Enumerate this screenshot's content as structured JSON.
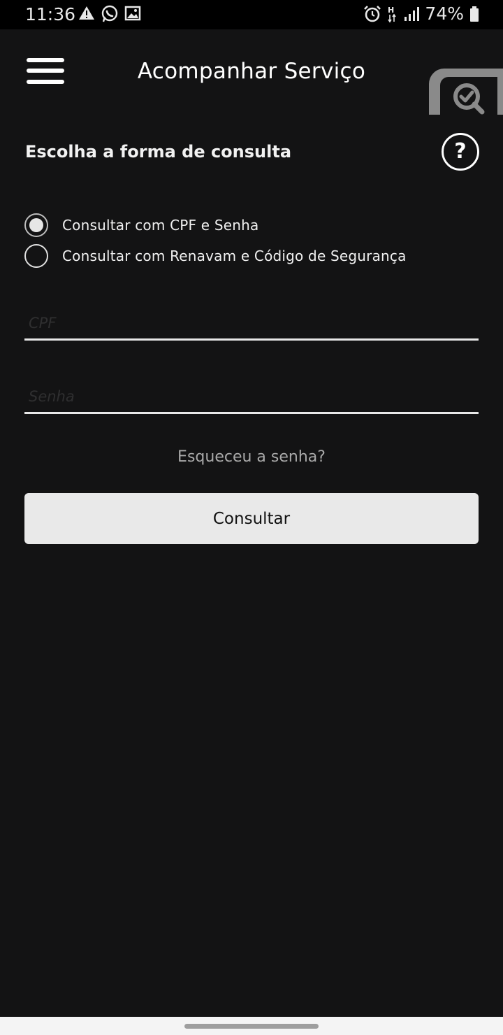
{
  "status_bar": {
    "time": "11:36",
    "battery_percent": "74%",
    "left_icons": [
      "warning-icon",
      "whatsapp-icon",
      "image-icon"
    ],
    "right_icons": [
      "alarm-icon",
      "h-plus-data-icon",
      "signal-icon",
      "battery-icon"
    ]
  },
  "app_bar": {
    "title": "Acompanhar Serviço",
    "menu_icon": "hamburger-menu-icon",
    "action_icon": "search-check-icon"
  },
  "form": {
    "section_title": "Escolha a forma de consulta",
    "help_icon_text": "?",
    "options": [
      {
        "label": "Consultar com CPF e Senha",
        "selected": true
      },
      {
        "label": "Consultar com Renavam e Código de Segurança",
        "selected": false
      }
    ],
    "cpf": {
      "placeholder": "CPF",
      "value": ""
    },
    "senha": {
      "placeholder": "Senha",
      "value": ""
    },
    "forgot_link": "Esqueceu a senha?",
    "submit_label": "Consultar"
  },
  "colors": {
    "background": "#131314",
    "status_bar": "#000000",
    "button": "#e9e9e9",
    "muted_text": "#a9a9a9"
  }
}
